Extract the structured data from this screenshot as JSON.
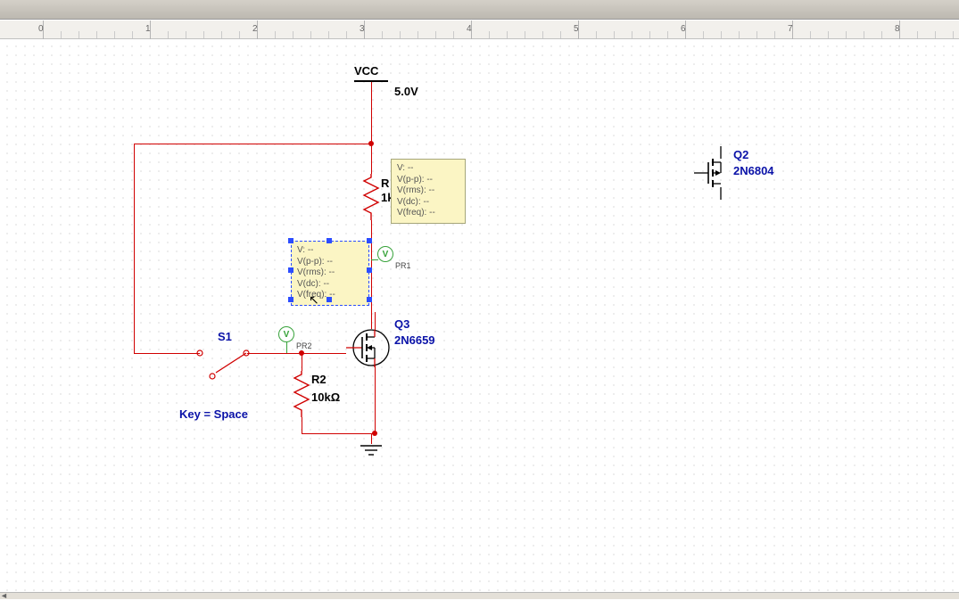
{
  "ruler": {
    "ticks": [
      "0",
      "1",
      "2",
      "3",
      "4",
      "5",
      "6",
      "7",
      "8"
    ]
  },
  "vcc": {
    "label": "VCC",
    "value": "5.0V"
  },
  "r1": {
    "name": "R",
    "value": "1k"
  },
  "r2": {
    "name": "R2",
    "value": "10kΩ"
  },
  "s1": {
    "name": "S1",
    "key": "Key = Space"
  },
  "q3": {
    "name": "Q3",
    "part": "2N6659"
  },
  "q2": {
    "name": "Q2",
    "part": "2N6804"
  },
  "pr1": {
    "label": "PR1"
  },
  "pr2": {
    "label": "PR2"
  },
  "probe_lines": [
    "V: --",
    "V(p-p): --",
    "V(rms): --",
    "V(dc): --",
    "V(freq): --"
  ]
}
